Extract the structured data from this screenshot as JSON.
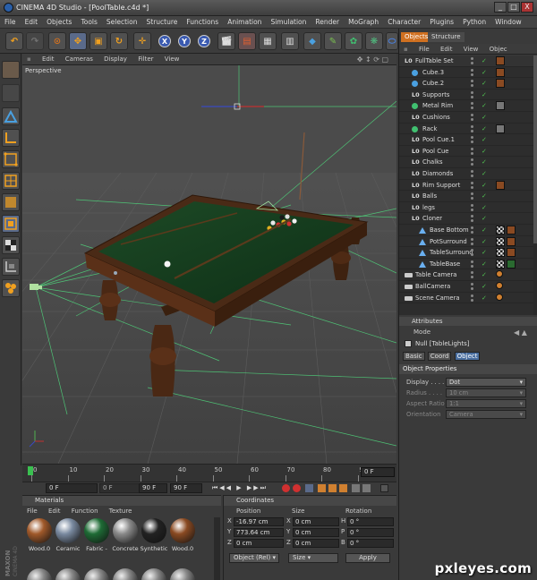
{
  "window": {
    "title": "CINEMA 4D Studio - [PoolTable.c4d *]",
    "controls": [
      "_",
      "□",
      "X"
    ]
  },
  "menubar": [
    "File",
    "Edit",
    "Objects",
    "Tools",
    "Selection",
    "Structure",
    "Functions",
    "Animation",
    "Simulation",
    "Render",
    "MoGraph",
    "Character",
    "Plugins",
    "Python",
    "Window",
    "Help"
  ],
  "toolbar": {
    "axis_labels": [
      "X",
      "Y",
      "Z"
    ]
  },
  "viewport": {
    "menu": [
      "Edit",
      "Cameras",
      "Display",
      "Filter",
      "View"
    ],
    "label": "Perspective"
  },
  "timeline": {
    "ticks": [
      "0",
      "10",
      "20",
      "30",
      "40",
      "50",
      "60",
      "70",
      "80",
      "90"
    ],
    "end_label": "0 F",
    "fields": [
      "0 F",
      "0 F",
      "90 F",
      "90 F"
    ]
  },
  "materials": {
    "header": "Materials",
    "menu": [
      "File",
      "Edit",
      "Function",
      "Texture"
    ],
    "items": [
      {
        "label": "Wood.0",
        "color": "#a0592a"
      },
      {
        "label": "Ceramic",
        "color": "#7a8aa0"
      },
      {
        "label": "Fabric -",
        "color": "#1e6b35"
      },
      {
        "label": "Concrete",
        "color": "#8a8a8a"
      },
      {
        "label": "Synthetic",
        "color": "#222222"
      },
      {
        "label": "Wood.0",
        "color": "#8a4a22"
      }
    ]
  },
  "coordinates": {
    "header": "Coordinates",
    "columns": [
      "Position",
      "Size",
      "Rotation"
    ],
    "rows": [
      {
        "axis": "X",
        "pos": "-16.97 cm",
        "size_axis": "X",
        "size": "0 cm",
        "rot_axis": "H",
        "rot": "0 °"
      },
      {
        "axis": "Y",
        "pos": "773.64 cm",
        "size_axis": "Y",
        "size": "0 cm",
        "rot_axis": "P",
        "rot": "0 °"
      },
      {
        "axis": "Z",
        "pos": "0 cm",
        "size_axis": "Z",
        "size": "0 cm",
        "rot_axis": "B",
        "rot": "0 °"
      }
    ],
    "mode": "Object (Rel)",
    "size_mode": "Size",
    "apply": "Apply"
  },
  "objects_panel": {
    "tabs": [
      "Objects",
      "Structure"
    ],
    "menu": [
      "File",
      "Edit",
      "View",
      "Objec"
    ],
    "items": [
      {
        "name": "FullTable Set",
        "type": "null",
        "indent": 0,
        "tags": [
          "wood"
        ]
      },
      {
        "name": "Cube.3",
        "type": "cube",
        "indent": 1,
        "tags": [
          "wood"
        ]
      },
      {
        "name": "Cube.2",
        "type": "cube",
        "indent": 1,
        "tags": [
          "wood"
        ]
      },
      {
        "name": "Supports",
        "type": "null",
        "indent": 1,
        "tags": []
      },
      {
        "name": "Metal Rim",
        "type": "metal",
        "indent": 1,
        "tags": [
          "metal"
        ]
      },
      {
        "name": "Cushions",
        "type": "null",
        "indent": 1,
        "tags": []
      },
      {
        "name": "Rack",
        "type": "metal",
        "indent": 1,
        "tags": [
          "metal"
        ]
      },
      {
        "name": "Pool Cue.1",
        "type": "null",
        "indent": 1,
        "tags": []
      },
      {
        "name": "Pool Cue",
        "type": "null",
        "indent": 1,
        "tags": []
      },
      {
        "name": "Chalks",
        "type": "null",
        "indent": 1,
        "tags": []
      },
      {
        "name": "Diamonds",
        "type": "null",
        "indent": 1,
        "tags": []
      },
      {
        "name": "Rim Support",
        "type": "null",
        "indent": 1,
        "tags": [
          "wood"
        ]
      },
      {
        "name": "Balls",
        "type": "null",
        "indent": 1,
        "tags": []
      },
      {
        "name": "legs",
        "type": "null",
        "indent": 1,
        "tags": []
      },
      {
        "name": "Cloner",
        "type": "null",
        "indent": 1,
        "tags": []
      },
      {
        "name": "Base Bottom",
        "type": "sweep",
        "indent": 2,
        "tags": [
          "checker",
          "wood"
        ]
      },
      {
        "name": "PotSurround",
        "type": "sweep",
        "indent": 2,
        "tags": [
          "checker",
          "wood"
        ]
      },
      {
        "name": "TableSurround",
        "type": "sweep",
        "indent": 2,
        "tags": [
          "checker",
          "wood"
        ]
      },
      {
        "name": "TableBase",
        "type": "sweep",
        "indent": 2,
        "tags": [
          "checker",
          "green"
        ]
      },
      {
        "name": "Table Camera",
        "type": "camera",
        "indent": 0,
        "tags": [
          "target"
        ]
      },
      {
        "name": "BallCamera",
        "type": "camera",
        "indent": 0,
        "tags": [
          "target"
        ]
      },
      {
        "name": "Scene Camera",
        "type": "camera",
        "indent": 0,
        "tags": [
          "target"
        ]
      }
    ]
  },
  "attributes": {
    "header": "Attributes",
    "mode": "Mode",
    "object_name": "Null [TableLights]",
    "tabs": [
      "Basic",
      "Coord",
      "Object"
    ],
    "active_tab": "Object",
    "section": "Object Properties",
    "props": [
      {
        "label": "Display . . . .",
        "value": "Dot",
        "enabled": true
      },
      {
        "label": "Radius . . . .",
        "value": "10 cm",
        "enabled": false
      },
      {
        "label": "Aspect Ratio",
        "value": "1:1",
        "enabled": false
      },
      {
        "label": "Orientation",
        "value": "Camera",
        "enabled": false
      }
    ]
  },
  "branding": {
    "side_logo": "MAXON CINEMA 4D",
    "watermark": "pxleyes.com"
  }
}
